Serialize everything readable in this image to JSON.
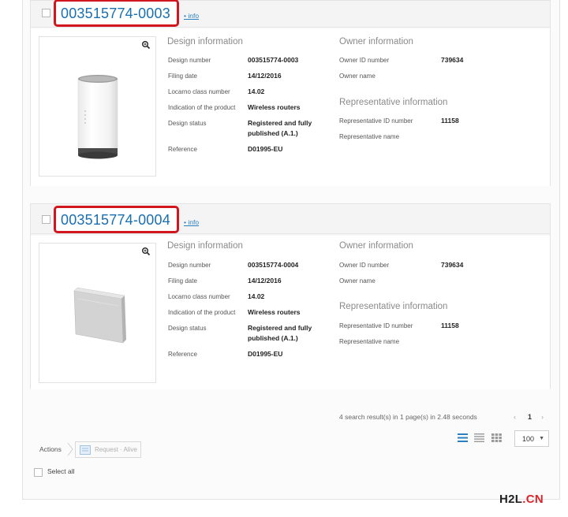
{
  "results": [
    {
      "design_id": "003515774-0003",
      "info_link": "• info",
      "design_information_title": "Design information",
      "owner_information_title": "Owner information",
      "representative_information_title": "Representative information",
      "fields": {
        "design_number_label": "Design number",
        "design_number": "003515774-0003",
        "filing_date_label": "Filing date",
        "filing_date": "14/12/2016",
        "locarno_label": "Locarno class number",
        "locarno": "14.02",
        "product_label": "Indication of the product",
        "product": "Wireless routers",
        "status_label": "Design status",
        "status_line1": "Registered and fully",
        "status_line2": "published (A.1.)",
        "reference_label": "Reference",
        "reference": "D01995-EU",
        "owner_id_label": "Owner ID number",
        "owner_id": "739634",
        "owner_name_label": "Owner name",
        "rep_id_label": "Representative ID number",
        "rep_id": "11158",
        "rep_name_label": "Representative name"
      },
      "image_icon": "router-cylinder-image"
    },
    {
      "design_id": "003515774-0004",
      "info_link": "• info",
      "design_information_title": "Design information",
      "owner_information_title": "Owner information",
      "representative_information_title": "Representative information",
      "fields": {
        "design_number_label": "Design number",
        "design_number": "003515774-0004",
        "filing_date_label": "Filing date",
        "filing_date": "14/12/2016",
        "locarno_label": "Locarno class number",
        "locarno": "14.02",
        "product_label": "Indication of the product",
        "product": "Wireless routers",
        "status_label": "Design status",
        "status_line1": "Registered and fully",
        "status_line2": "published (A.1.)",
        "reference_label": "Reference",
        "reference": "D01995-EU",
        "owner_id_label": "Owner ID number",
        "owner_id": "739634",
        "owner_name_label": "Owner name",
        "rep_id_label": "Representative ID number",
        "rep_id": "11158",
        "rep_name_label": "Representative name"
      },
      "image_icon": "router-flat-panel-image"
    }
  ],
  "footer": {
    "results_text": "4 search result(s) in 1 page(s) in 2.48 seconds",
    "pager_prev": "‹",
    "current_page": "1",
    "pager_next": "›",
    "per_page": "100",
    "actions_label": "Actions",
    "request_button": "Request · Alive",
    "select_all": "Select all"
  },
  "watermark": {
    "part1": "H2L",
    "part2": ".CN"
  },
  "colors": {
    "title_blue": "#1a6fb0",
    "highlight_red": "#d2161e",
    "link_blue": "#2a7fbf"
  },
  "icons": [
    "zoom-icon",
    "list-view-icon",
    "compact-view-icon",
    "grid-view-icon",
    "chevron-right-icon",
    "request-icon",
    "caret-down-icon"
  ]
}
